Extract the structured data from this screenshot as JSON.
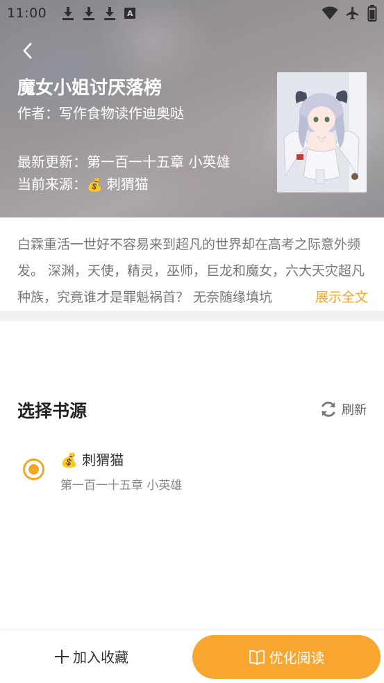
{
  "status_bar": {
    "time": "11:00",
    "notification_icons": [
      "download-icon",
      "download-icon",
      "download-icon",
      "a-icon"
    ],
    "right_icons": [
      "wifi-icon",
      "airplane-icon",
      "battery-icon"
    ],
    "a_label": "A"
  },
  "book": {
    "title": "魔女小姐讨厌落榜",
    "author": "作者：写作食物读作迪奥哒",
    "latest_update": "最新更新：第一百一十五章 小英雄",
    "current_source_label": "当前来源：",
    "current_source_name": "刺猬猫",
    "money_glyph": "💰",
    "synopsis": "白霖重活一世好不容易来到超凡的世界却在高考之际意外频发。 深渊，天使，精灵，巫师，巨龙和魔女，六大天灾超凡种族，究竟谁才是罪魁祸首？ 无奈随缘填坑",
    "expand_label": "展示全文"
  },
  "source_section": {
    "title": "选择书源",
    "refresh_label": "刷新",
    "options": [
      {
        "name": "刺猬猫",
        "chapter": "第一百一十五章 小英雄",
        "selected": true
      }
    ]
  },
  "bottom_bar": {
    "collect_label": "加入收藏",
    "read_label": "优化阅读"
  },
  "colors": {
    "accent": "#f5a623",
    "button": "#f8a630"
  }
}
